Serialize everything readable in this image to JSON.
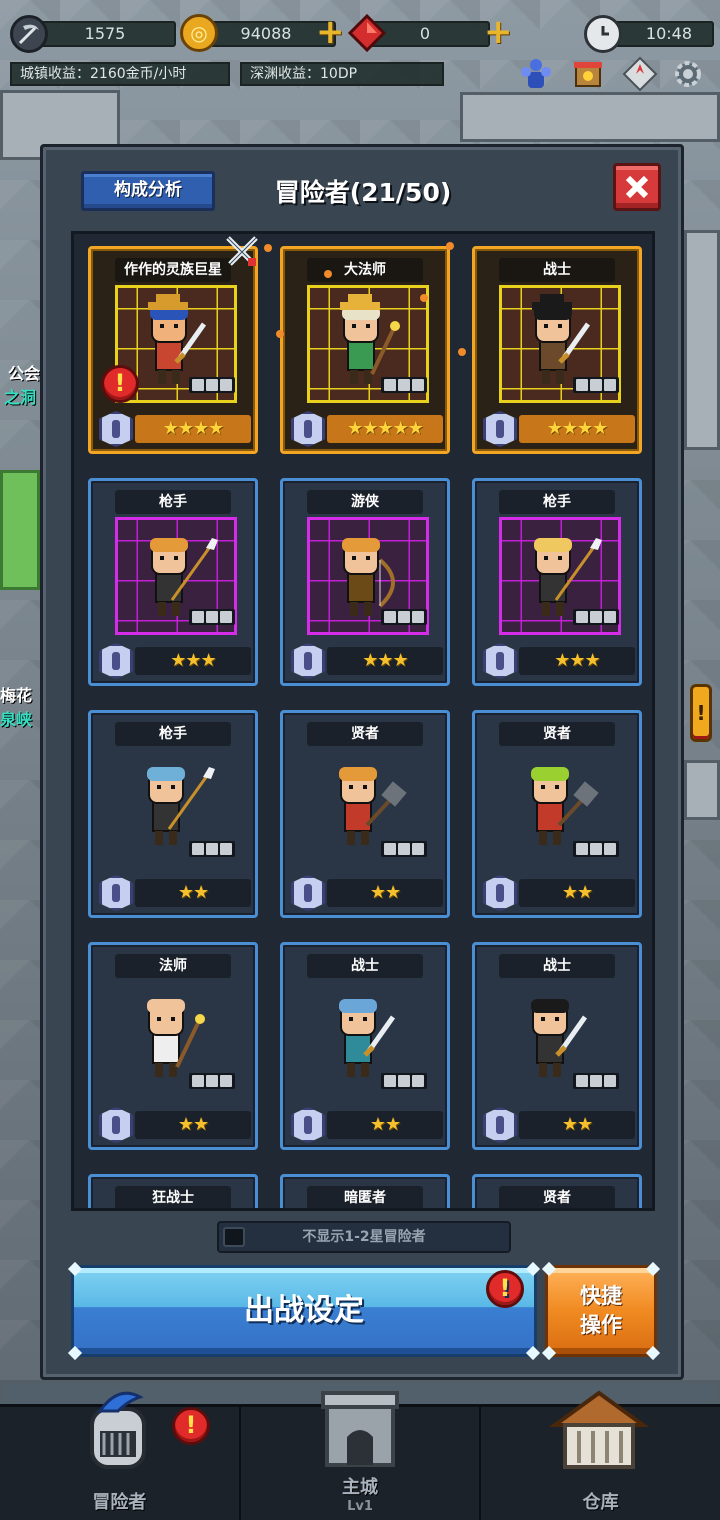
{
  "hud": {
    "souls": "1575",
    "gold": "94088",
    "gems": "0",
    "time": "10:48",
    "town_income": "城镇收益：2160金币/小时",
    "abyss_income": "深渊收益：10DP"
  },
  "background": {
    "sign_guild": "公会",
    "sign_cave": "之洞",
    "sign_plum": "梅花",
    "sign_spring": "泉峡"
  },
  "panel": {
    "analysis_button": "构成分析",
    "title": "冒险者(21/50)",
    "filter_label": "不显示1-2星冒险者",
    "deploy_button": "出战设定",
    "quick_button_line1": "快捷",
    "quick_button_line2": "操作"
  },
  "adventurers": [
    {
      "name": "作作的灵族巨星",
      "stars": "★★★★",
      "rarity": "gold",
      "alert": true
    },
    {
      "name": "大法师",
      "stars": "★★★★★",
      "rarity": "gold",
      "alert": false
    },
    {
      "name": "战士",
      "stars": "★★★★",
      "rarity": "gold",
      "alert": false
    },
    {
      "name": "枪手",
      "stars": "★★★",
      "rarity": "purple",
      "alert": false
    },
    {
      "name": "游侠",
      "stars": "★★★",
      "rarity": "purple",
      "alert": false
    },
    {
      "name": "枪手",
      "stars": "★★★",
      "rarity": "purple",
      "alert": false
    },
    {
      "name": "枪手",
      "stars": "★★",
      "rarity": "plain",
      "alert": false
    },
    {
      "name": "贤者",
      "stars": "★★",
      "rarity": "plain",
      "alert": false
    },
    {
      "name": "贤者",
      "stars": "★★",
      "rarity": "plain",
      "alert": false
    },
    {
      "name": "法师",
      "stars": "★★",
      "rarity": "plain",
      "alert": false
    },
    {
      "name": "战士",
      "stars": "★★",
      "rarity": "plain",
      "alert": false
    },
    {
      "name": "战士",
      "stars": "★★",
      "rarity": "plain",
      "alert": false
    },
    {
      "name": "狂战士",
      "stars": "",
      "rarity": "plain",
      "alert": false
    },
    {
      "name": "暗匿者",
      "stars": "",
      "rarity": "plain",
      "alert": false
    },
    {
      "name": "贤者",
      "stars": "",
      "rarity": "plain",
      "alert": false
    }
  ],
  "nav": {
    "adventurers": "冒险者",
    "castle": "主城",
    "castle_level": "Lv1",
    "warehouse": "仓库"
  },
  "colors": {
    "gold_frame": "#f2a623",
    "blue_frame": "#4a8fd3",
    "purple_grid": "#c21fd6",
    "star": "#f5c02c",
    "deploy_blue": "#5ab8e6",
    "quick_orange": "#f08a21",
    "alert_red": "#e12b2b"
  },
  "icons": {
    "souls": "scythe-icon",
    "gold": "gold-coin-icon",
    "gems": "red-gem-icon",
    "time": "clock-icon",
    "close": "close-icon",
    "alert": "exclamation-icon",
    "settings": "gear-icon"
  }
}
